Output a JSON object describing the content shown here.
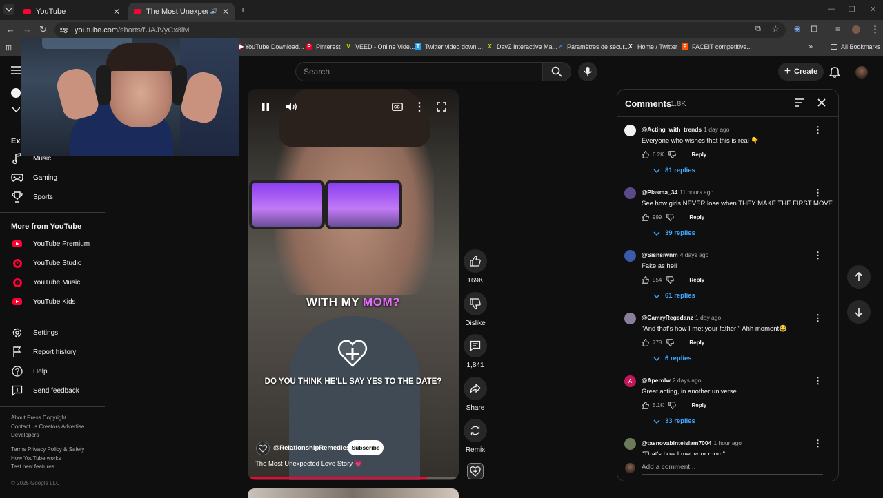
{
  "browser": {
    "tabs": [
      {
        "title": "YouTube"
      },
      {
        "title": "The Most Unexpected Love"
      }
    ],
    "url_host": "youtube.com",
    "url_path": "/shorts/fUAJVyCx8lM",
    "bookmarks": [
      {
        "label": "YouTube Download...",
        "color": "#ff0033",
        "glyph": "▶"
      },
      {
        "label": "Pinterest",
        "color": "#e60023",
        "glyph": "P"
      },
      {
        "label": "VEED - Online Vide...",
        "color": "#b6f500",
        "glyph": "V"
      },
      {
        "label": "Twitter video downl...",
        "color": "#1da1f2",
        "glyph": "T"
      },
      {
        "label": "DayZ Interactive Ma...",
        "color": "#c6e11b",
        "glyph": "X"
      },
      {
        "label": "Paramètres de sécur...",
        "color": "#4285f4",
        "glyph": "↗"
      },
      {
        "label": "Home / Twitter",
        "color": "#000000",
        "glyph": "X"
      },
      {
        "label": "FACEIT competitive...",
        "color": "#ff5500",
        "glyph": "F"
      }
    ],
    "all_bookmarks": "All Bookmarks"
  },
  "header": {
    "search_placeholder": "Search",
    "create_label": "Create"
  },
  "sidebar": {
    "explore_heading": "Exp",
    "explore_items": [
      {
        "label": "Music",
        "icon": "music-note-icon"
      },
      {
        "label": "Gaming",
        "icon": "gamepad-icon"
      },
      {
        "label": "Sports",
        "icon": "trophy-icon"
      }
    ],
    "more_heading": "More from YouTube",
    "more_items": [
      {
        "label": "YouTube Premium"
      },
      {
        "label": "YouTube Studio"
      },
      {
        "label": "YouTube Music"
      },
      {
        "label": "YouTube Kids"
      }
    ],
    "settings_items": [
      {
        "label": "Settings"
      },
      {
        "label": "Report history"
      },
      {
        "label": "Help"
      },
      {
        "label": "Send feedback"
      }
    ],
    "footer_line1": "About  Press  Copyright",
    "footer_line2": "Contact us  Creators  Advertise",
    "footer_line3": "Developers",
    "footer_line4": "Terms  Privacy  Policy & Safety",
    "footer_line5": "How YouTube works",
    "footer_line6": "Test new features",
    "copyright": "© 2025 Google LLC"
  },
  "video": {
    "caption_top_white": "WITH MY ",
    "caption_top_pink": "MOM?",
    "caption_bottom": "DO YOU THINK HE'LL SAY YES TO THE DATE?",
    "channel": "@RelationshipRemedies",
    "subscribe": "Subscribe",
    "title": "The Most Unexpected Love Story 💗",
    "progress": 0.85
  },
  "actions": {
    "likes": "169K",
    "dislike": "Dislike",
    "comments": "1,841",
    "share": "Share",
    "remix": "Remix"
  },
  "comments_panel": {
    "title": "Comments",
    "count": "1.8K",
    "add_placeholder": "Add a comment...",
    "items": [
      {
        "author": "@Acting_with_trends",
        "time": "1 day ago",
        "text": "Everyone who wishes that this is real 👇",
        "likes": "6.2K",
        "reply": "Reply",
        "replies": "81 replies",
        "avatar_color": "#f1f1f1"
      },
      {
        "author": "@Plasma_34",
        "time": "11 hours ago",
        "text": "See how girls NEVER lose when THEY MAKE THE FIRST MOVE",
        "likes": "999",
        "reply": "Reply",
        "replies": "39 replies",
        "avatar_color": "#5b4a8a"
      },
      {
        "author": "@Sisnsiwnm",
        "time": "4 days ago",
        "text": "Fake as hell",
        "likes": "954",
        "reply": "Reply",
        "replies": "61 replies",
        "avatar_color": "#3d5aa8"
      },
      {
        "author": "@CamryRegedanz",
        "time": "1 day ago",
        "text": "\"And that's how I met your father \" Ahh moment😂",
        "likes": "778",
        "reply": "Reply",
        "replies": "6 replies",
        "avatar_color": "#8a7f9a"
      },
      {
        "author": "@Aperolw",
        "time": "2 days ago",
        "text": "Great acting, in another universe.",
        "likes": "5.1K",
        "reply": "Reply",
        "replies": "33 replies",
        "avatar_color": "#c2185b",
        "avatar_letter": "A"
      },
      {
        "author": "@tasnovabinteislam7004",
        "time": "1 hour ago",
        "text": "\"That's how I met your mom\"",
        "likes": "",
        "reply": "",
        "replies": "",
        "avatar_color": "#6d7a5a"
      }
    ]
  },
  "colors": {
    "accent": "#ff0033",
    "link": "#3ea6ff",
    "background": "#0f0f0f"
  }
}
